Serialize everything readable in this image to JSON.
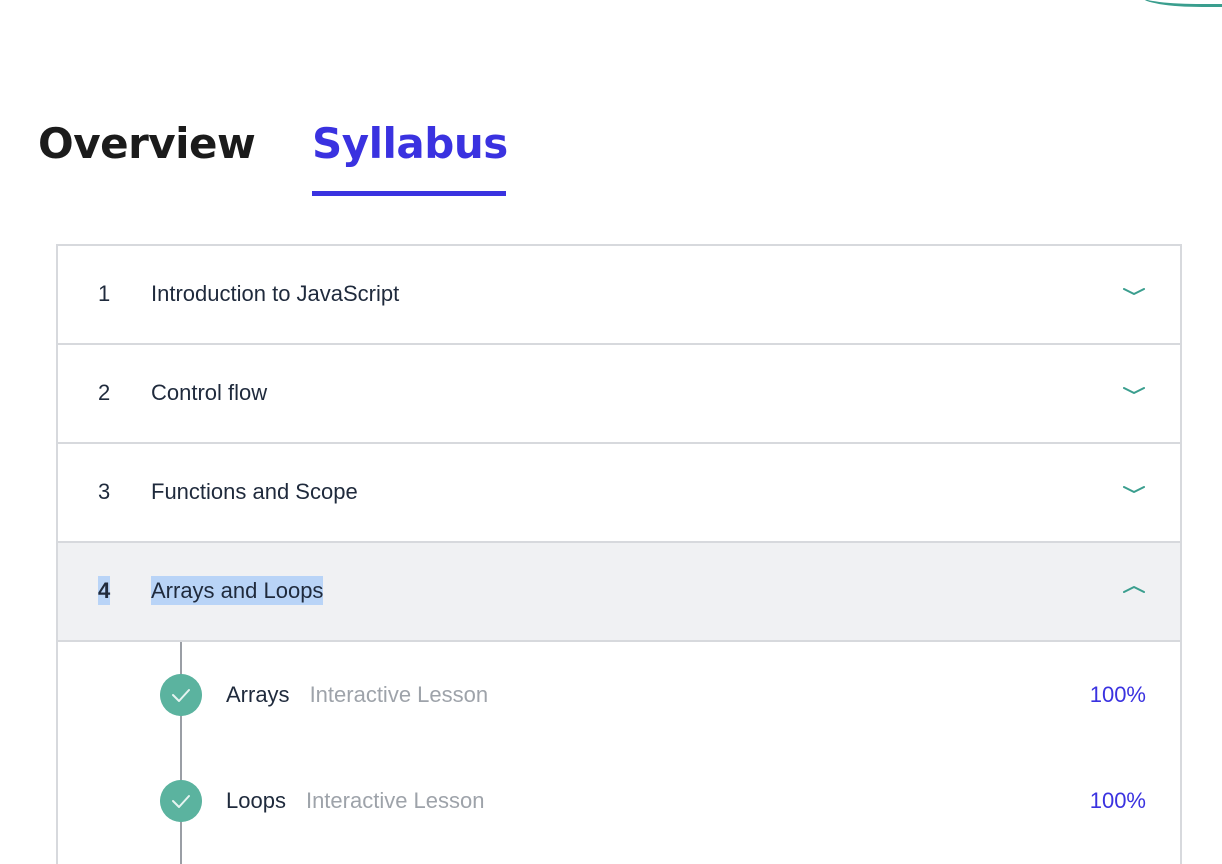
{
  "tabs": [
    {
      "label": "Overview",
      "active": false
    },
    {
      "label": "Syllabus",
      "active": true
    }
  ],
  "colors": {
    "accent": "#3a32e0",
    "check": "#5bb39f",
    "chevron": "#3a9e8e",
    "expanded_bg": "#f0f1f3",
    "selection": "#b9d4f7"
  },
  "modules": [
    {
      "number": "1",
      "title": "Introduction to JavaScript",
      "expanded": false,
      "icon": "chevron-down-icon"
    },
    {
      "number": "2",
      "title": "Control flow",
      "expanded": false,
      "icon": "chevron-down-icon"
    },
    {
      "number": "3",
      "title": "Functions and Scope",
      "expanded": false,
      "icon": "chevron-down-icon"
    },
    {
      "number": "4",
      "title": "Arrays and Loops",
      "expanded": true,
      "icon": "chevron-up-icon"
    }
  ],
  "lessons": [
    {
      "name": "Arrays",
      "type": "Interactive Lesson",
      "progress": "100%",
      "completed": true,
      "icon": "checkmark-icon"
    },
    {
      "name": "Loops",
      "type": "Interactive Lesson",
      "progress": "100%",
      "completed": true,
      "icon": "checkmark-icon"
    }
  ]
}
